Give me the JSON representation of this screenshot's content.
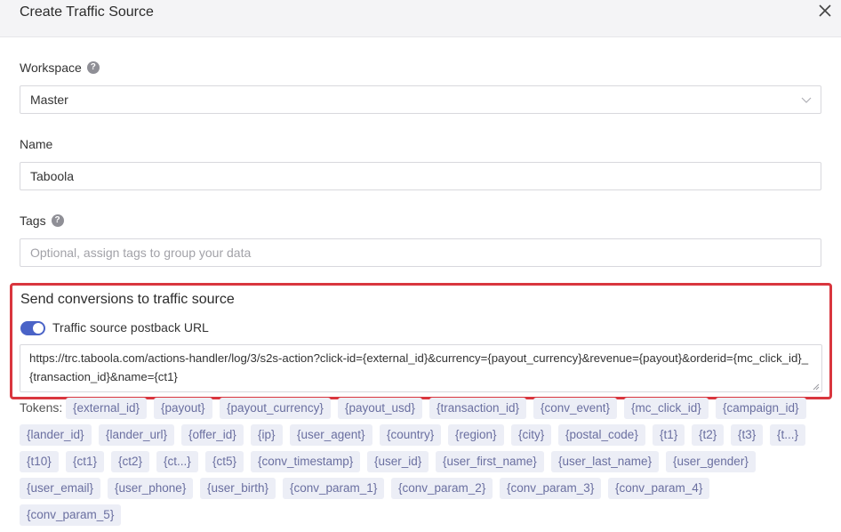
{
  "dialog": {
    "title": "Create Traffic Source",
    "close_icon": "close-icon"
  },
  "workspace": {
    "label": "Workspace",
    "value": "Master"
  },
  "name": {
    "label": "Name",
    "value": "Taboola"
  },
  "tags": {
    "label": "Tags",
    "placeholder": "Optional, assign tags to group your data"
  },
  "conversions": {
    "heading": "Send conversions to traffic source",
    "toggle_label": "Traffic source postback URL",
    "toggle_on": true,
    "accent": "#4a63c7",
    "highlight_border": "#d9363e",
    "postback_url": "https://trc.taboola.com/actions-handler/log/3/s2s-action?click-id={external_id}&currency={payout_currency}&revenue={payout}&orderid={mc_click_id}_{transaction_id}&name={ct1}"
  },
  "tokens": {
    "label": "Tokens:",
    "items": [
      "{external_id}",
      "{payout}",
      "{payout_currency}",
      "{payout_usd}",
      "{transaction_id}",
      "{conv_event}",
      "{mc_click_id}",
      "{campaign_id}",
      "{lander_id}",
      "{lander_url}",
      "{offer_id}",
      "{ip}",
      "{user_agent}",
      "{country}",
      "{region}",
      "{city}",
      "{postal_code}",
      "{t1}",
      "{t2}",
      "{t3}",
      "{t...}",
      "{t10}",
      "{ct1}",
      "{ct2}",
      "{ct...}",
      "{ct5}",
      "{conv_timestamp}",
      "{user_id}",
      "{user_first_name}",
      "{user_last_name}",
      "{user_gender}",
      "{user_email}",
      "{user_phone}",
      "{user_birth}",
      "{conv_param_1}",
      "{conv_param_2}",
      "{conv_param_3}",
      "{conv_param_4}",
      "{conv_param_5}"
    ]
  }
}
